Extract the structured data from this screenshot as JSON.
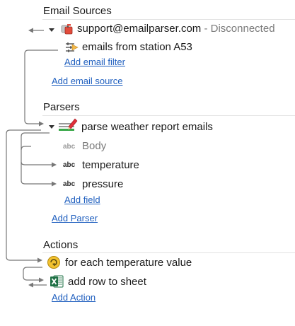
{
  "sections": {
    "email_sources": {
      "title": "Email Sources",
      "source": {
        "name": "support@emailparser.com",
        "status": "- Disconnected"
      },
      "filter": {
        "name": "emails from station A53"
      },
      "add_filter_label": "Add email filter",
      "add_source_label": "Add email source"
    },
    "parsers": {
      "title": "Parsers",
      "parser": {
        "name": "parse weather report emails"
      },
      "fields": [
        {
          "badge": "abc",
          "label": "Body"
        },
        {
          "badge": "abc",
          "label": "temperature"
        },
        {
          "badge": "abc",
          "label": "pressure"
        }
      ],
      "add_field_label": "Add field",
      "add_parser_label": "Add Parser"
    },
    "actions": {
      "title": "Actions",
      "items": [
        {
          "label": "for each temperature value"
        },
        {
          "label": "add row to sheet"
        }
      ],
      "add_action_label": "Add Action"
    }
  },
  "colors": {
    "link": "#1f5fbf",
    "disconnected": "#7a7a7a",
    "connector": "#777777",
    "excel_green": "#1e7145",
    "foreach_yellow": "#f2c230"
  }
}
